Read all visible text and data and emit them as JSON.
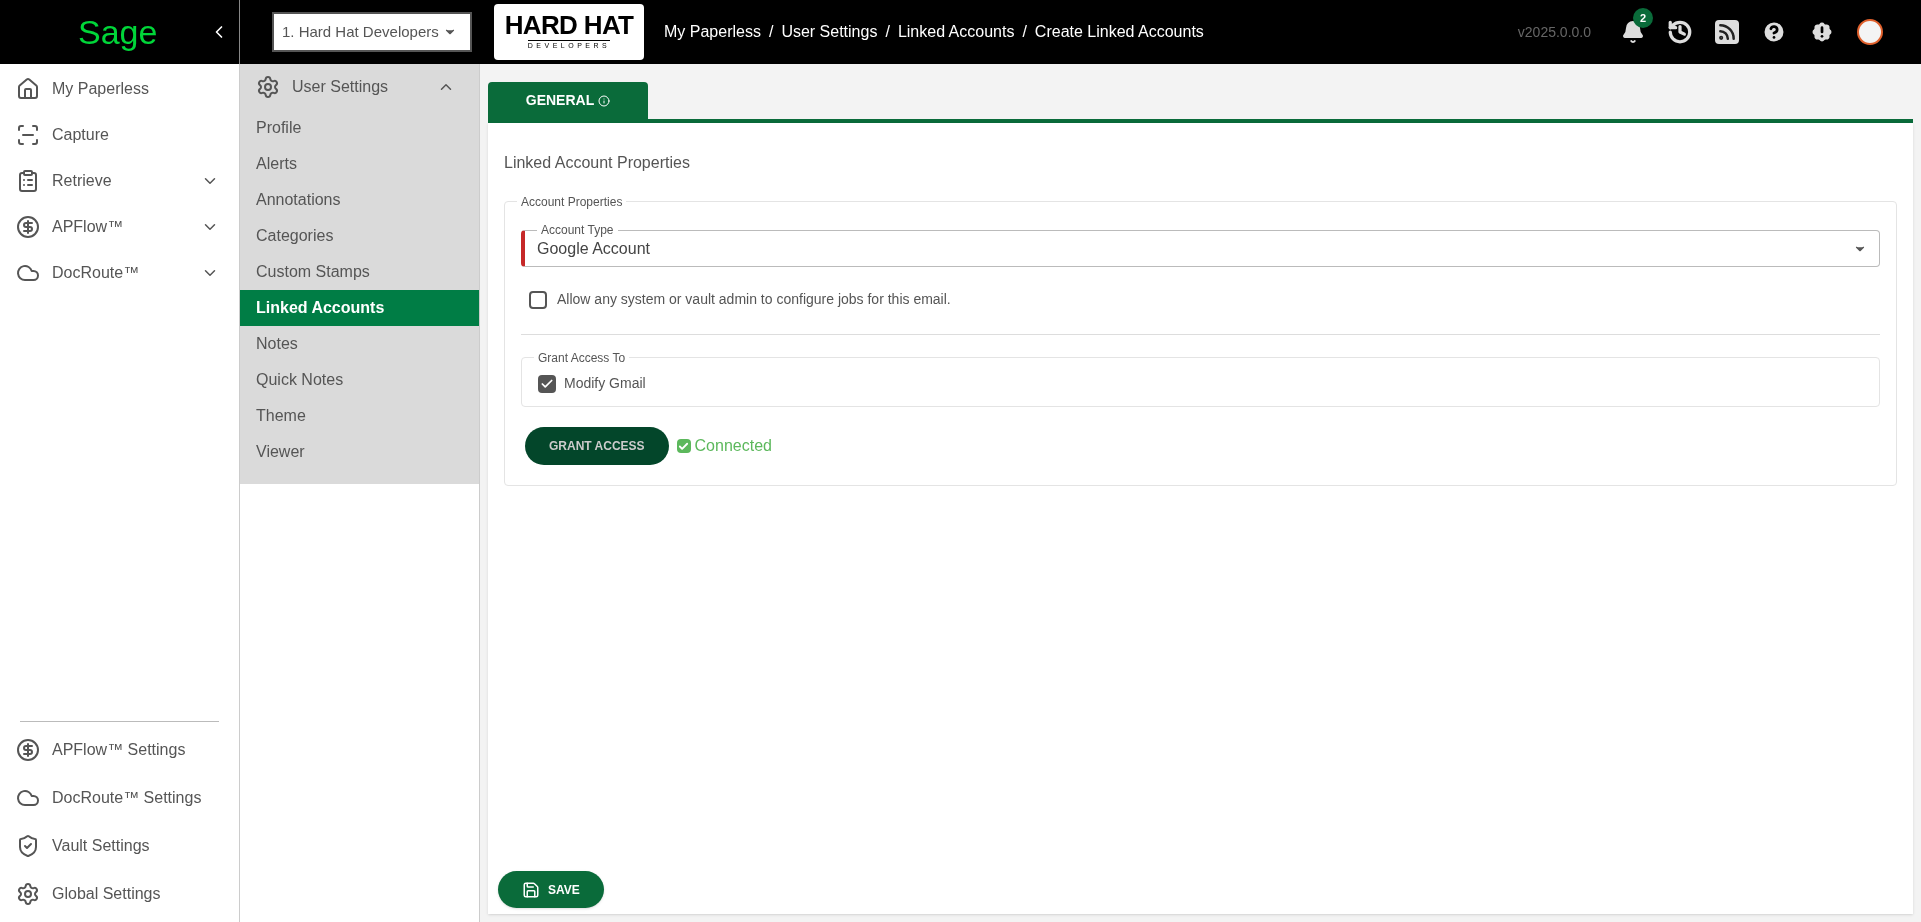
{
  "brand": {
    "logo": "Sage"
  },
  "company_select": {
    "value": "1. Hard Hat Developers"
  },
  "company_logo": {
    "title": "HARD HAT",
    "subtitle": "DEVELOPERS"
  },
  "breadcrumbs": [
    {
      "label": "My Paperless"
    },
    {
      "separator": "/",
      "label": "User Settings"
    },
    {
      "separator": "/",
      "label": "Linked Accounts"
    },
    {
      "separator": "/",
      "label": "Create Linked Accounts"
    }
  ],
  "version": "v2025.0.0.0",
  "notifications": {
    "count": "2"
  },
  "nav": {
    "items": [
      {
        "label": "My Paperless",
        "expandable": false
      },
      {
        "label": "Capture",
        "expandable": false
      },
      {
        "label": "Retrieve",
        "expandable": true
      },
      {
        "label": "APFlow™",
        "expandable": true
      },
      {
        "label": "DocRoute™",
        "expandable": true
      }
    ],
    "bottom_items": [
      "APFlow™ Settings",
      "DocRoute™ Settings",
      "Vault Settings",
      "Global Settings"
    ]
  },
  "settings_menu": {
    "title": "User Settings",
    "expanded": true,
    "items": [
      {
        "label": "Profile",
        "selected": false
      },
      {
        "label": "Alerts",
        "selected": false
      },
      {
        "label": "Annotations",
        "selected": false
      },
      {
        "label": "Categories",
        "selected": false
      },
      {
        "label": "Custom Stamps",
        "selected": false
      },
      {
        "label": "Linked Accounts",
        "selected": true
      },
      {
        "label": "Notes",
        "selected": false
      },
      {
        "label": "Quick Notes",
        "selected": false
      },
      {
        "label": "Theme",
        "selected": false
      },
      {
        "label": "Viewer",
        "selected": false
      }
    ]
  },
  "tabs": [
    {
      "label": "GENERAL",
      "selected": true
    }
  ],
  "section_title": "Linked Account Properties",
  "account_properties": {
    "legend": "Account Properties",
    "account_type": {
      "label": "Account Type",
      "value": "Google Account",
      "required": true
    },
    "admin_option": {
      "label": "Allow any system or vault admin to configure jobs for this email.",
      "checked": false
    },
    "grant_access": {
      "legend": "Grant Access To",
      "options": [
        {
          "label": "Modify Gmail",
          "checked": true
        }
      ]
    },
    "grant_button": "GRANT ACCESS",
    "status": {
      "label": "Connected",
      "connected": true
    }
  },
  "save_button": "SAVE"
}
